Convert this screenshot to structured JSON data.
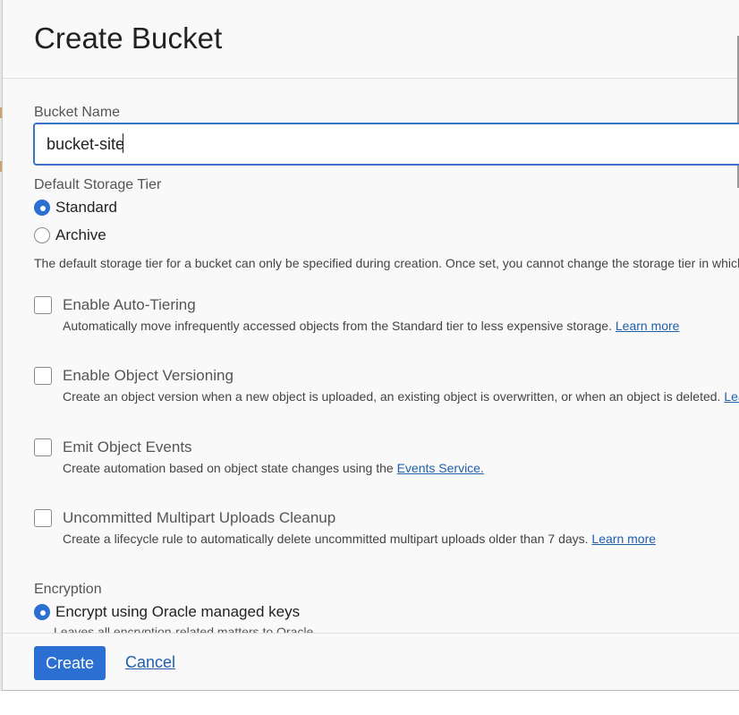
{
  "dialog": {
    "title": "Create Bucket"
  },
  "bucket_name": {
    "label": "Bucket Name",
    "value": "bucket-site"
  },
  "storage_tier": {
    "label": "Default Storage Tier",
    "options": [
      {
        "label": "Standard",
        "checked": true
      },
      {
        "label": "Archive",
        "checked": false
      }
    ],
    "note": "The default storage tier for a bucket can only be specified during creation. Once set, you cannot change the storage tier in which a"
  },
  "options": [
    {
      "title": "Enable Auto-Tiering",
      "desc": "Automatically move infrequently accessed objects from the Standard tier to less expensive storage. ",
      "link": "Learn more",
      "checked": false
    },
    {
      "title": "Enable Object Versioning",
      "desc": "Create an object version when a new object is uploaded, an existing object is overwritten, or when an object is deleted. ",
      "link": "Learn",
      "checked": false
    },
    {
      "title": "Emit Object Events",
      "desc": "Create automation based on object state changes using the ",
      "link": "Events Service.",
      "checked": false
    },
    {
      "title": "Uncommitted Multipart Uploads Cleanup",
      "desc": "Create a lifecycle rule to automatically delete uncommitted multipart uploads older than 7 days. ",
      "link": "Learn more",
      "checked": false
    }
  ],
  "encryption": {
    "label": "Encryption",
    "option": "Encrypt using Oracle managed keys",
    "option_checked": true,
    "option_desc": "Leaves all encryption-related matters to Oracle."
  },
  "footer": {
    "create_label": "Create",
    "cancel_label": "Cancel"
  },
  "colors": {
    "accent": "#2c6fd3",
    "link": "#1f5fa9",
    "panel_bg": "#f9f9f9"
  }
}
